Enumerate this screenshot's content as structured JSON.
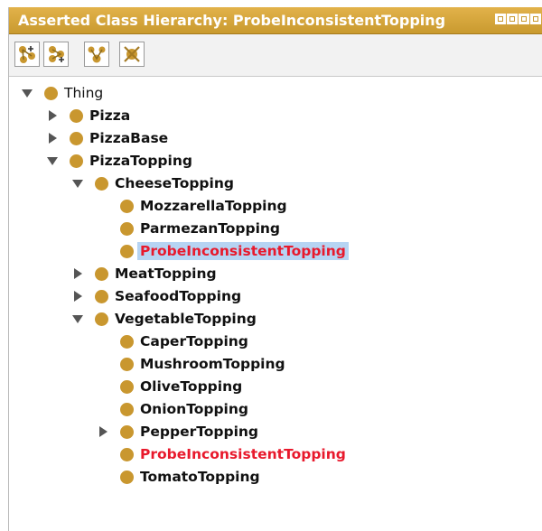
{
  "window": {
    "title": "Asserted Class Hierarchy: ProbeInconsistentTopping",
    "colors": {
      "titlebar": "#d4a43b",
      "bullet": "#c9972f",
      "inconsistent": "#e8192c",
      "selection": "#b6d4f3"
    }
  },
  "toolbar": {
    "buttons": [
      {
        "name": "add-subclass-button",
        "icon": "add-subclass-icon"
      },
      {
        "name": "add-sibling-button",
        "icon": "add-sibling-icon"
      },
      {
        "name": "create-hierarchy-button",
        "icon": "hierarchy-icon"
      },
      {
        "name": "delete-class-button",
        "icon": "delete-class-icon"
      }
    ]
  },
  "tree": {
    "nodes": [
      {
        "label": "Thing",
        "depth": 0,
        "arrow": "expanded",
        "style": "plain"
      },
      {
        "label": "Pizza",
        "depth": 1,
        "arrow": "collapsed",
        "style": "bold"
      },
      {
        "label": "PizzaBase",
        "depth": 1,
        "arrow": "collapsed",
        "style": "bold"
      },
      {
        "label": "PizzaTopping",
        "depth": 1,
        "arrow": "expanded",
        "style": "bold"
      },
      {
        "label": "CheeseTopping",
        "depth": 2,
        "arrow": "expanded",
        "style": "bold"
      },
      {
        "label": "MozzarellaTopping",
        "depth": 3,
        "arrow": "none",
        "style": "bold"
      },
      {
        "label": "ParmezanTopping",
        "depth": 3,
        "arrow": "none",
        "style": "bold"
      },
      {
        "label": "ProbeInconsistentTopping",
        "depth": 3,
        "arrow": "none",
        "style": "red-selected"
      },
      {
        "label": "MeatTopping",
        "depth": 2,
        "arrow": "collapsed",
        "style": "bold"
      },
      {
        "label": "SeafoodTopping",
        "depth": 2,
        "arrow": "collapsed",
        "style": "bold"
      },
      {
        "label": "VegetableTopping",
        "depth": 2,
        "arrow": "expanded",
        "style": "bold"
      },
      {
        "label": "CaperTopping",
        "depth": 3,
        "arrow": "none",
        "style": "bold"
      },
      {
        "label": "MushroomTopping",
        "depth": 3,
        "arrow": "none",
        "style": "bold"
      },
      {
        "label": "OliveTopping",
        "depth": 3,
        "arrow": "none",
        "style": "bold"
      },
      {
        "label": "OnionTopping",
        "depth": 3,
        "arrow": "none",
        "style": "bold"
      },
      {
        "label": "PepperTopping",
        "depth": 3,
        "arrow": "collapsed",
        "style": "bold"
      },
      {
        "label": "ProbeInconsistentTopping",
        "depth": 3,
        "arrow": "none",
        "style": "red"
      },
      {
        "label": "TomatoTopping",
        "depth": 3,
        "arrow": "none",
        "style": "bold"
      }
    ]
  }
}
